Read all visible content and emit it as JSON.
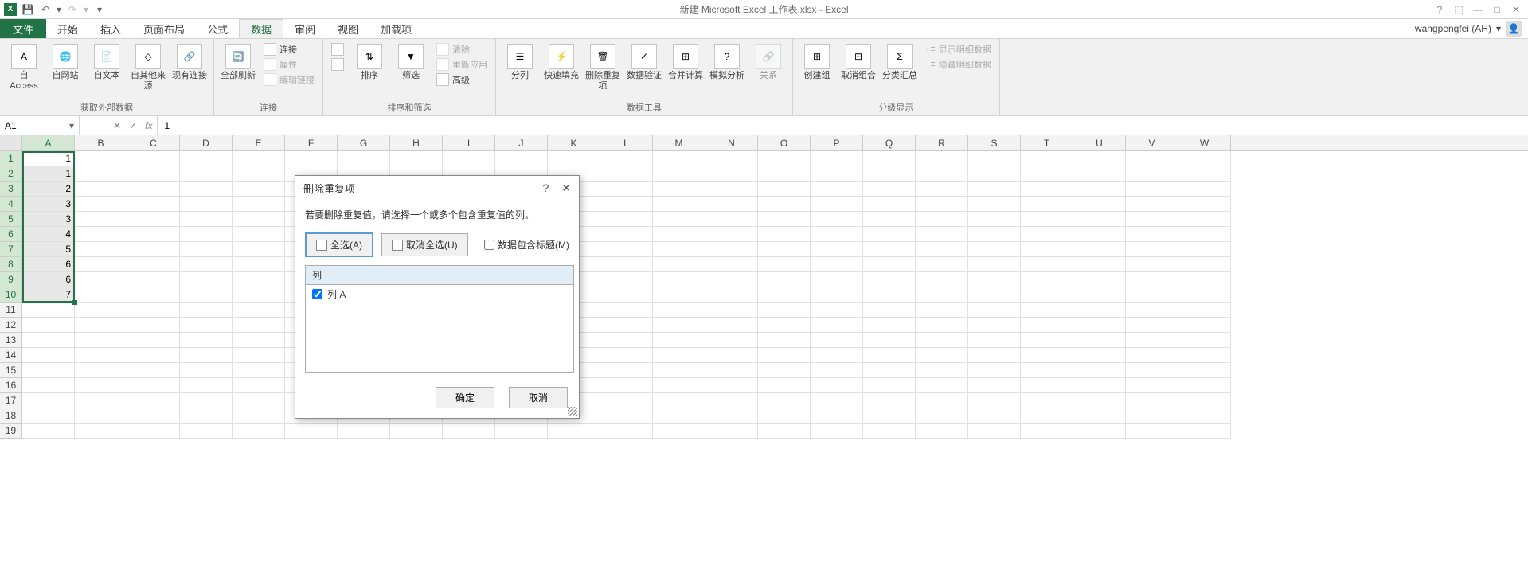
{
  "titlebar": {
    "doc_title": "新建 Microsoft Excel 工作表.xlsx - Excel"
  },
  "account": {
    "name": "wangpengfei (AH)"
  },
  "tabs": {
    "file": "文件",
    "home": "开始",
    "insert": "插入",
    "page_layout": "页面布局",
    "formulas": "公式",
    "data": "数据",
    "review": "审阅",
    "view": "视图",
    "addins": "加载项"
  },
  "ribbon": {
    "group_external": "获取外部数据",
    "from_access": "自 Access",
    "from_web": "自网站",
    "from_text": "自文本",
    "from_other": "自其他来源",
    "existing_conn": "现有连接",
    "group_conn": "连接",
    "refresh_all": "全部刷新",
    "connections": "连接",
    "properties": "属性",
    "edit_links": "编辑链接",
    "group_sort": "排序和筛选",
    "sort_az": "A↓Z",
    "sort_za": "Z↓A",
    "sort": "排序",
    "filter": "筛选",
    "clear": "清除",
    "reapply": "重新应用",
    "advanced": "高级",
    "group_tools": "数据工具",
    "text_to_cols": "分列",
    "flash_fill": "快速填充",
    "remove_dup": "删除重复项",
    "data_val": "数据验证",
    "consolidate": "合并计算",
    "whatif": "模拟分析",
    "relations": "关系",
    "group_outline": "分级显示",
    "group_btn": "创建组",
    "ungroup_btn": "取消组合",
    "subtotal": "分类汇总",
    "show_detail": "显示明细数据",
    "hide_detail": "隐藏明细数据"
  },
  "namebox": "A1",
  "formula": "1",
  "columns": [
    "A",
    "B",
    "C",
    "D",
    "E",
    "F",
    "G",
    "H",
    "I",
    "J",
    "K",
    "L",
    "M",
    "N",
    "O",
    "P",
    "Q",
    "R",
    "S",
    "T",
    "U",
    "V",
    "W"
  ],
  "cell_data": [
    "1",
    "1",
    "2",
    "3",
    "3",
    "4",
    "5",
    "6",
    "6",
    "7"
  ],
  "dialog": {
    "title": "删除重复项",
    "instruction": "若要删除重复值，请选择一个或多个包含重复值的列。",
    "select_all": "全选(A)",
    "unselect_all": "取消全选(U)",
    "has_header": "数据包含标题(M)",
    "col_header": "列",
    "col_a": "列 A",
    "ok": "确定",
    "cancel": "取消"
  }
}
